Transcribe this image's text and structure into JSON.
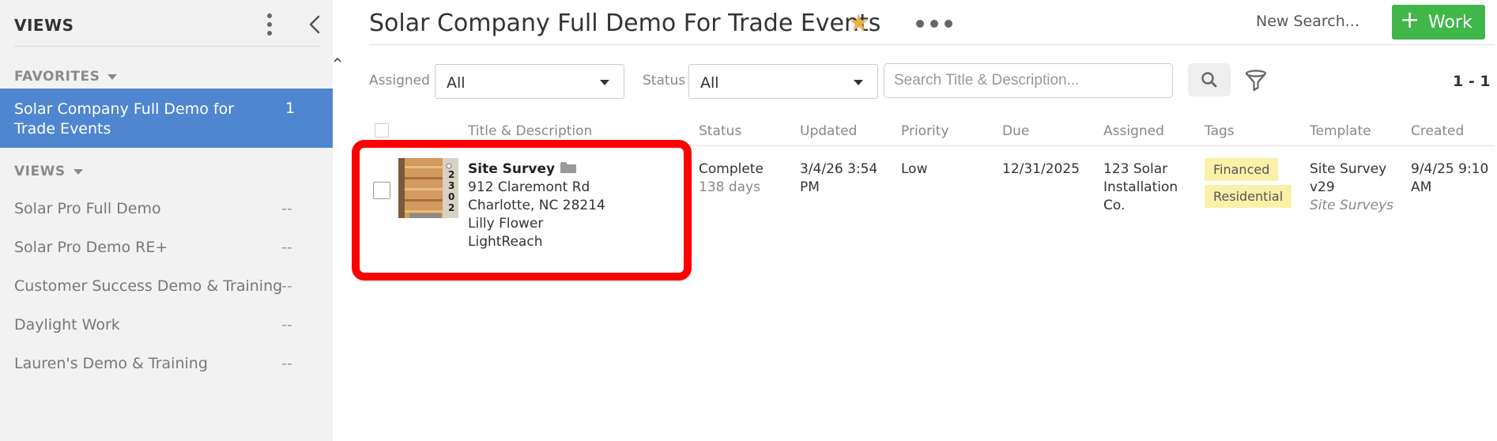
{
  "sidebar": {
    "title": "VIEWS",
    "favorites_label": "FAVORITES",
    "views_label": "VIEWS",
    "active": {
      "label": "Solar Company Full Demo for Trade Events",
      "count": "1"
    },
    "items": [
      {
        "label": "Solar Pro Full Demo",
        "count": "--"
      },
      {
        "label": "Solar Pro Demo RE+",
        "count": "--"
      },
      {
        "label": "Customer Success Demo & Training",
        "count": "--"
      },
      {
        "label": "Daylight Work",
        "count": "--"
      },
      {
        "label": "Lauren's Demo & Training",
        "count": "--"
      }
    ]
  },
  "header": {
    "title": "Solar Company Full Demo For Trade Events",
    "new_search": "New Search...",
    "work_button": "Work",
    "accent": "#41b649",
    "star_color": "#e8b14a"
  },
  "filters": {
    "assigned_label": "Assigned",
    "assigned_value": "All",
    "status_label": "Status",
    "status_value": "All",
    "search_placeholder": "Search Title & Description...",
    "search_value": "",
    "range": "1 - 1"
  },
  "table": {
    "columns": [
      "Title & Description",
      "Status",
      "Updated",
      "Priority",
      "Due",
      "Assigned",
      "Tags",
      "Template",
      "Created"
    ],
    "rows": [
      {
        "title": "Site Survey",
        "address1": "912 Claremont Rd",
        "address2": "Charlotte, NC 28214",
        "contact": "Lilly Flower",
        "company": "LightReach",
        "status": "Complete",
        "status_age": "138 days",
        "updated_line1": "3/4/26 3:54",
        "updated_line2": "PM",
        "priority": "Low",
        "due": "12/31/2025",
        "assigned_line1": "123 Solar",
        "assigned_line2": "Installation",
        "assigned_line3": "Co.",
        "tags": [
          "Financed",
          "Residential"
        ],
        "template_line1": "Site Survey",
        "template_line2": "v29",
        "template_category": "Site Surveys",
        "created_line1": "9/4/25 9:10",
        "created_line2": "AM",
        "thumbnail_text": "2302"
      }
    ]
  },
  "highlight_color": "#ff0000",
  "active_color": "#4f86cf"
}
